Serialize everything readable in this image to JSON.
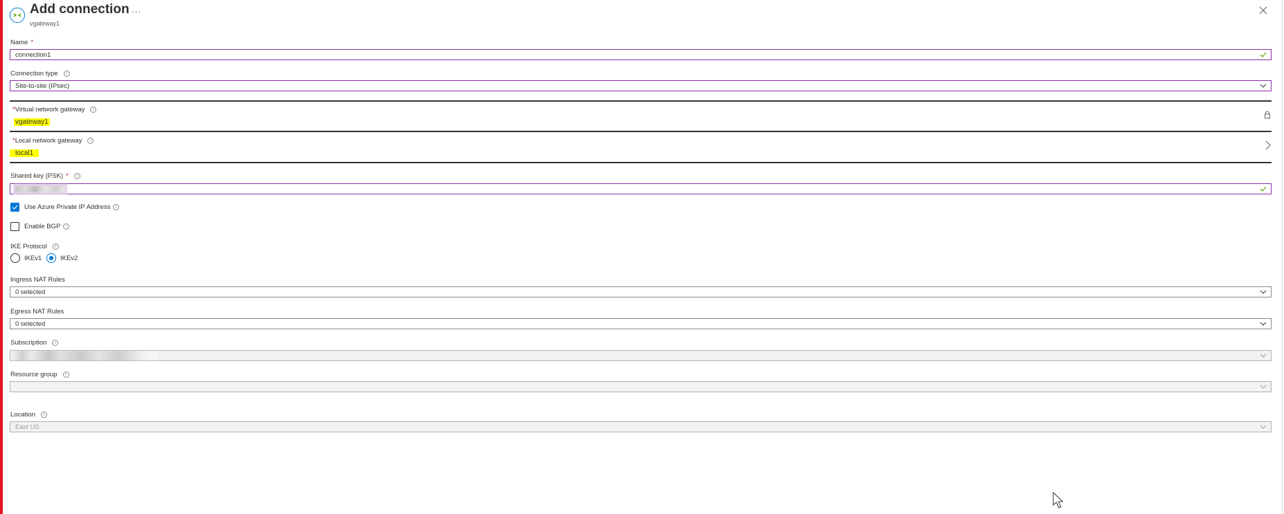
{
  "header": {
    "title": "Add connection",
    "subtitle": "vgateway1",
    "more_label": "...",
    "close_icon": "close-icon",
    "header_icon": "connection-icon"
  },
  "form": {
    "name": {
      "label": "Name",
      "required": "*",
      "value": "connection1",
      "valid_icon": "check-icon"
    },
    "connection_type": {
      "label": "Connection type",
      "value": "Site-to-site (IPsec)",
      "info": "i"
    },
    "virtual_network_gateway": {
      "required": "*",
      "label": "Virtual network gateway",
      "value": "vgateway1",
      "info": "i",
      "icon": "lock-icon"
    },
    "local_network_gateway": {
      "required": "*",
      "label": "Local network gateway",
      "value": "local1",
      "info": "i",
      "icon": "chevron-right-icon"
    },
    "shared_key": {
      "label": "Shared key (PSK)",
      "required": "*",
      "info": "i",
      "valid_icon": "check-icon"
    },
    "use_private_ip": {
      "label": "Use Azure Private IP Address",
      "checked": true,
      "info": "i"
    },
    "enable_bgp": {
      "label": "Enable BGP",
      "checked": false,
      "info": "i"
    },
    "ike_protocol": {
      "label": "IKE Protocol",
      "info": "i",
      "options": [
        {
          "label": "IKEv1",
          "selected": false
        },
        {
          "label": "IKEv2",
          "selected": true
        }
      ]
    },
    "ingress_nat": {
      "label": "Ingress NAT Rules",
      "value": "0 selected"
    },
    "egress_nat": {
      "label": "Egress NAT Rules",
      "value": "0 selected"
    },
    "subscription": {
      "label": "Subscription",
      "info": "i"
    },
    "resource_group": {
      "label": "Resource group",
      "info": "i",
      "value": ""
    },
    "location": {
      "label": "Location",
      "info": "i",
      "value": "East US"
    }
  },
  "colors": {
    "accent": "#0078d4",
    "focus_border": "#8a2da5",
    "valid_check": "#57a300",
    "highlight": "#ffff00",
    "left_bar": "#e81123",
    "required": "#a4262c"
  }
}
